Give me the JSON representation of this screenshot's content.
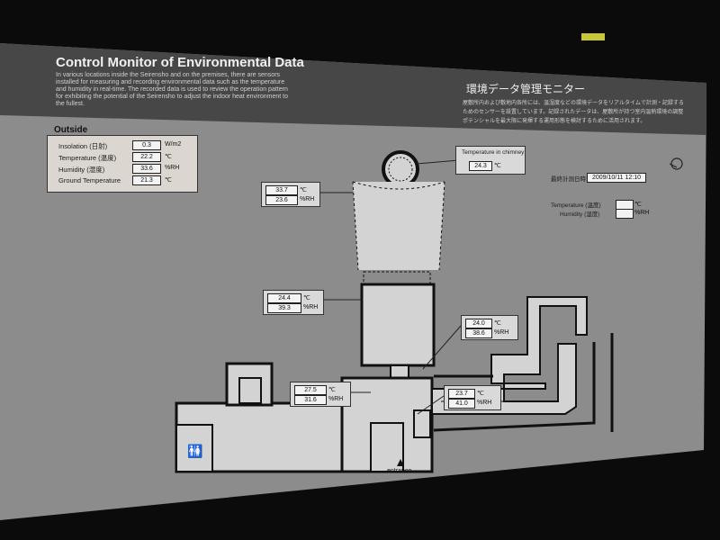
{
  "header": {
    "title_en": "Control Monitor of Environmental Data",
    "desc_en": [
      "In various locations inside the Seirensho and on the premises, there are sensors",
      "installed for measuring and recording environmental data such as the temperature",
      "and humidity in real-time. The recorded data is used to review the operation pattern",
      "for exhibiting the potential of the Seirensho to adjust the indoor heat environment to",
      "the fullest."
    ],
    "title_jp": "環境データ管理モニター",
    "desc_jp": [
      "屋敷所内および敷地内各所には、温湿度などの環境データをリアルタイムで計測・記録する",
      "ためのセンサーを設置しています。記録されたデータは、屋敷所が持つ室内温熱環境の調整",
      "ポテンシャルを最大限に発揮する運用形態を検討するために活用されます。"
    ]
  },
  "outside": {
    "heading": "Outside",
    "rows": [
      {
        "label": "Insolation (日射)",
        "value": "0.3",
        "unit": "W/m2"
      },
      {
        "label": "Temperature (温度)",
        "value": "22.2",
        "unit": "℃"
      },
      {
        "label": "Humidity (湿度)",
        "value": "33.6",
        "unit": "%RH"
      },
      {
        "label": "Ground Temperature",
        "value": "21.3",
        "unit": "℃"
      }
    ]
  },
  "chimney": {
    "label": "Temperature in chimney",
    "value": "24.3",
    "unit": "℃"
  },
  "clock": {
    "label": "最終計測日時:",
    "value": "2009/10/11 12:10"
  },
  "legend": {
    "temp_label": "Temperature (温度)",
    "temp_unit": "℃",
    "hum_label": "Humidity (湿度)",
    "hum_unit": "%RH"
  },
  "sensors": [
    {
      "id": "upper-chimney",
      "temp": "33.7",
      "hum": "23.6"
    },
    {
      "id": "lower-chimney",
      "temp": "24.4",
      "hum": "39.3"
    },
    {
      "id": "right-hall",
      "temp": "24.0",
      "hum": "38.6"
    },
    {
      "id": "left-hall",
      "temp": "27.5",
      "hum": "31.6"
    },
    {
      "id": "entrance-room",
      "temp": "23.7",
      "hum": "41.0"
    }
  ],
  "units": {
    "temp": "℃",
    "hum": "%RH"
  },
  "floorplan": {
    "entrance_label": "entrance"
  },
  "colors": {
    "screen": "#8d8d8d",
    "header": "#444444",
    "plan_fill": "#d4d4d4",
    "wall": "#111111"
  }
}
